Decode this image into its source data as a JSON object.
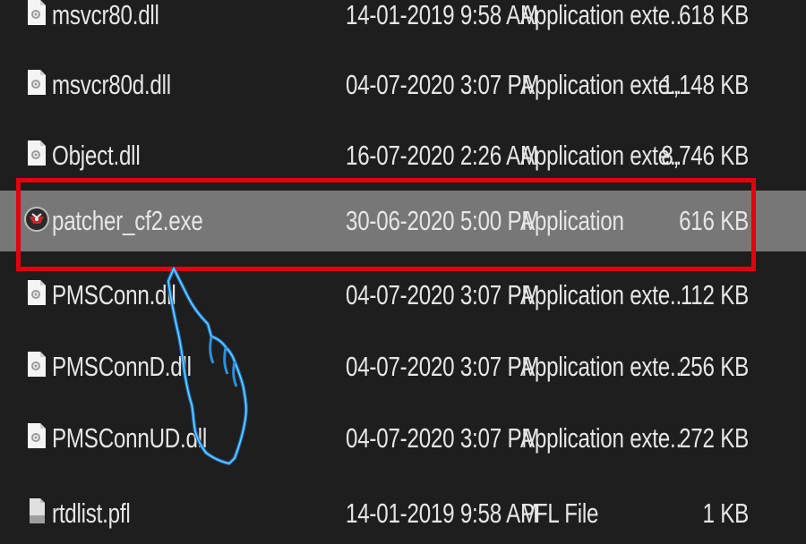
{
  "files": [
    {
      "name": "msvcr80.dll",
      "date": "14-01-2019 9:58 AM",
      "type": "Application exte...",
      "size": "618 KB",
      "icon": "dll-file-icon"
    },
    {
      "name": "msvcr80d.dll",
      "date": "04-07-2020 3:07 PM",
      "type": "Application exte...",
      "size": "1,148 KB",
      "icon": "dll-file-icon"
    },
    {
      "name": "Object.dll",
      "date": "16-07-2020 2:26 AM",
      "type": "Application exte...",
      "size": "8,746 KB",
      "icon": "dll-file-icon"
    },
    {
      "name": "patcher_cf2.exe",
      "date": "30-06-2020 5:00 PM",
      "type": "Application",
      "size": "616 KB",
      "icon": "patcher-app-icon",
      "selected": true
    },
    {
      "name": "PMSConn.dll",
      "date": "04-07-2020 3:07 PM",
      "type": "Application exte...",
      "size": "112 KB",
      "icon": "dll-file-icon"
    },
    {
      "name": "PMSConnD.dll",
      "date": "04-07-2020 3:07 PM",
      "type": "Application exte...",
      "size": "256 KB",
      "icon": "dll-file-icon"
    },
    {
      "name": "PMSConnUD.dll",
      "date": "04-07-2020 3:07 PM",
      "type": "Application exte...",
      "size": "272 KB",
      "icon": "dll-file-icon"
    },
    {
      "name": "rtdlist.pfl",
      "date": "14-01-2019 9:58 AM",
      "type": "PFL File",
      "size": "1 KB",
      "icon": "pfl-file-icon"
    }
  ],
  "colors": {
    "background": "#1e1e1e",
    "selected_row": "#777777",
    "highlight_box": "#e3000f",
    "pointer_outline": "#2f8fd6"
  },
  "annotation": {
    "icon": "pointing-hand-icon"
  }
}
